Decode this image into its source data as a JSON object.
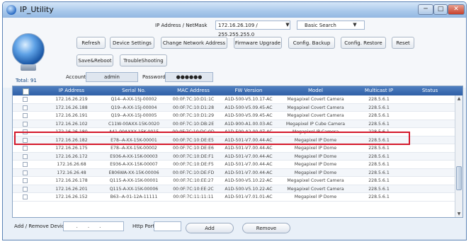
{
  "window": {
    "title": "IP_Utility",
    "min_symbol": "─",
    "max_symbol": "□",
    "close_symbol": "✕"
  },
  "filter": {
    "label": "IP Address / NetMask",
    "value": "172.16.26.109 / 255.255.255.0",
    "search_mode": "Basic Search"
  },
  "toolbar": {
    "refresh": "Refresh",
    "device_settings": "Device Settings",
    "change_network_address": "Change Network Address",
    "firmware_upgrade": "Firmware Upgrade",
    "config_backup": "Config. Backup",
    "config_restore": "Config. Restore",
    "reset": "Reset",
    "save_reboot": "Save&Reboot",
    "troubleshooting": "TroubleShooting"
  },
  "account": {
    "label": "Account",
    "value": "admin",
    "password_label": "Password",
    "password_value": "●●●●●●"
  },
  "total": "Total: 91",
  "table": {
    "headers": [
      "IP Address",
      "Serial No.",
      "MAC Address",
      "FW Version",
      "Model",
      "Multicast IP",
      "Status"
    ],
    "rows": [
      [
        "172.16.26.219",
        "Q14--A-XX-15J-00002",
        "00:0F:7C:10:D1:1C",
        "A1D-500-V5.10.17-AC",
        "Megapixel Covert Camera",
        "228.5.6.1",
        ""
      ],
      [
        "172.16.26.188",
        "Q19--A-XX-15J-00004",
        "00:0F:7C:10:D1:28",
        "A1D-500-V5.09.45-AC",
        "Megapixel Covert Camera",
        "228.5.6.1",
        ""
      ],
      [
        "172.16.26.191",
        "Q19--A-XX-15J-00005",
        "00:0F:7C:10:D1:29",
        "A1D-500-V5.09.45-AC",
        "Megapixel Covert Camera",
        "228.5.6.1",
        ""
      ],
      [
        "172.16.26.102",
        "C11W-00AXX-15K-0020",
        "00:0F:7C:10:DB:2E",
        "A1D-900-A1.00.03-AC",
        "Megapixel IP Cube Camera",
        "228.5.6.1",
        ""
      ],
      [
        "172.16.26.180",
        "A41-00AXXX-15K-0015",
        "00:0F:7C:10:DC:0D",
        "A1D-500-A2.00.07-AC",
        "Megapixel IP Camera",
        "228.5.6.1",
        ""
      ],
      [
        "172.16.26.182",
        "E78--A-XX-15K-00001",
        "00:0F:7C:10:DE:E5",
        "A1D-501-V7.00.44-AC",
        "Megapixel IP Dome",
        "228.5.6.1",
        ""
      ],
      [
        "172.16.26.175",
        "E78--A-XX-15K-00002",
        "00:0F:7C:10:DE:E6",
        "A1D-501-V7.00.44-AC",
        "Megapixel IP Dome",
        "228.5.6.1",
        ""
      ],
      [
        "172.16.26.172",
        "E936-A-XX-15K-00003",
        "00:0F:7C:10:DE:F1",
        "A1D-501-V7.00.44-AC",
        "Megapixel IP Dome",
        "228.5.6.1",
        ""
      ],
      [
        "172.16.26.68",
        "E936-A-XX-15K-00007",
        "00:0F:7C:10:DE:F5",
        "A1D-501-V7.00.44-AC",
        "Megapixel IP Dome",
        "228.5.6.1",
        ""
      ],
      [
        "172.16.26.48",
        "E806WA-XX-15K-00006",
        "00:0F:7C:10:DE:FD",
        "A1D-501-V7.00.44-AC",
        "Megapixel IP Dome",
        "228.5.6.1",
        ""
      ],
      [
        "172.16.26.178",
        "Q115-A-XX-15K-00001",
        "00:0F:7C:10:EE:27",
        "A1D-500-V5.10.22-AC",
        "Megapixel Covert Camera",
        "228.5.6.1",
        ""
      ],
      [
        "172.16.26.201",
        "Q115-A-XX-15K-00006",
        "00:0F:7C:10:EE:2C",
        "A1D-500-V5.10.22-AC",
        "Megapixel Covert Camera",
        "228.5.6.1",
        ""
      ],
      [
        "172.16.26.152",
        "B63--A-01-12A-11111",
        "00:0F:7C:11:11:11",
        "A1D-501-V7.01.01-AC",
        "Megapixel IP Dome",
        "228.5.6.1",
        ""
      ]
    ]
  },
  "bottom": {
    "add_remove_label": "Add / Remove Device",
    "ip_value": "...",
    "http_port_label": "Http Port",
    "add": "Add",
    "remove": "Remove"
  }
}
